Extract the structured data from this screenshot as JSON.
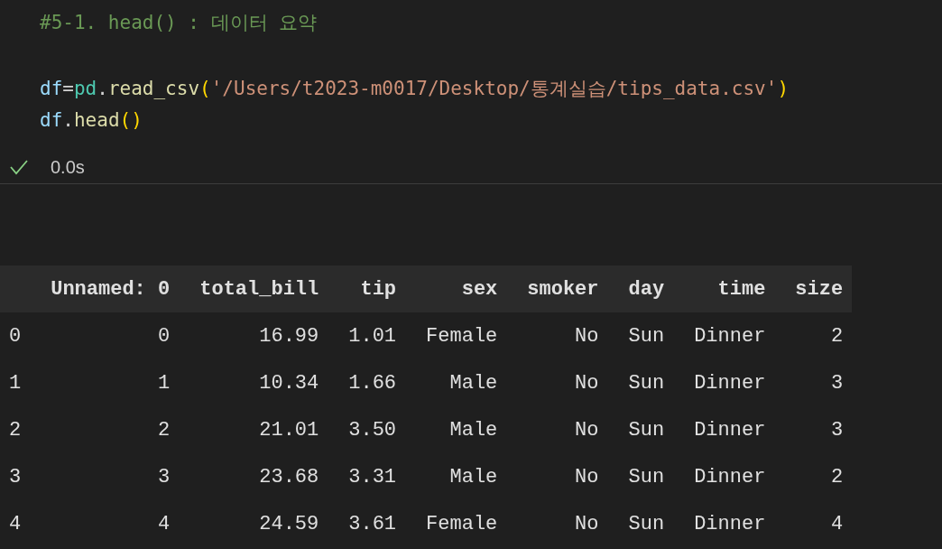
{
  "cell": {
    "comment": "#5-1. head() : 데이터 요약",
    "lines": [
      [
        {
          "text": "df",
          "kind": "variable"
        },
        {
          "text": "=",
          "kind": "operator"
        },
        {
          "text": "pd",
          "kind": "module"
        },
        {
          "text": ".",
          "kind": "operator"
        },
        {
          "text": "read_csv",
          "kind": "function"
        },
        {
          "text": "(",
          "kind": "paren"
        },
        {
          "text": "'/Users/t2023-m0017/Desktop/통계실습/tips_data.csv'",
          "kind": "string"
        },
        {
          "text": ")",
          "kind": "paren"
        }
      ],
      [
        {
          "text": "df",
          "kind": "variable"
        },
        {
          "text": ".",
          "kind": "operator"
        },
        {
          "text": "head",
          "kind": "function"
        },
        {
          "text": "()",
          "kind": "paren"
        }
      ]
    ]
  },
  "status": {
    "succeeded": true,
    "duration": "0.0s"
  },
  "table": {
    "columns": [
      "",
      "Unnamed: 0",
      "total_bill",
      "tip",
      "sex",
      "smoker",
      "day",
      "time",
      "size"
    ],
    "rows": [
      [
        "0",
        "0",
        "16.99",
        "1.01",
        "Female",
        "No",
        "Sun",
        "Dinner",
        "2"
      ],
      [
        "1",
        "1",
        "10.34",
        "1.66",
        "Male",
        "No",
        "Sun",
        "Dinner",
        "3"
      ],
      [
        "2",
        "2",
        "21.01",
        "3.50",
        "Male",
        "No",
        "Sun",
        "Dinner",
        "3"
      ],
      [
        "3",
        "3",
        "23.68",
        "3.31",
        "Male",
        "No",
        "Sun",
        "Dinner",
        "2"
      ],
      [
        "4",
        "4",
        "24.59",
        "3.61",
        "Female",
        "No",
        "Sun",
        "Dinner",
        "4"
      ]
    ]
  }
}
